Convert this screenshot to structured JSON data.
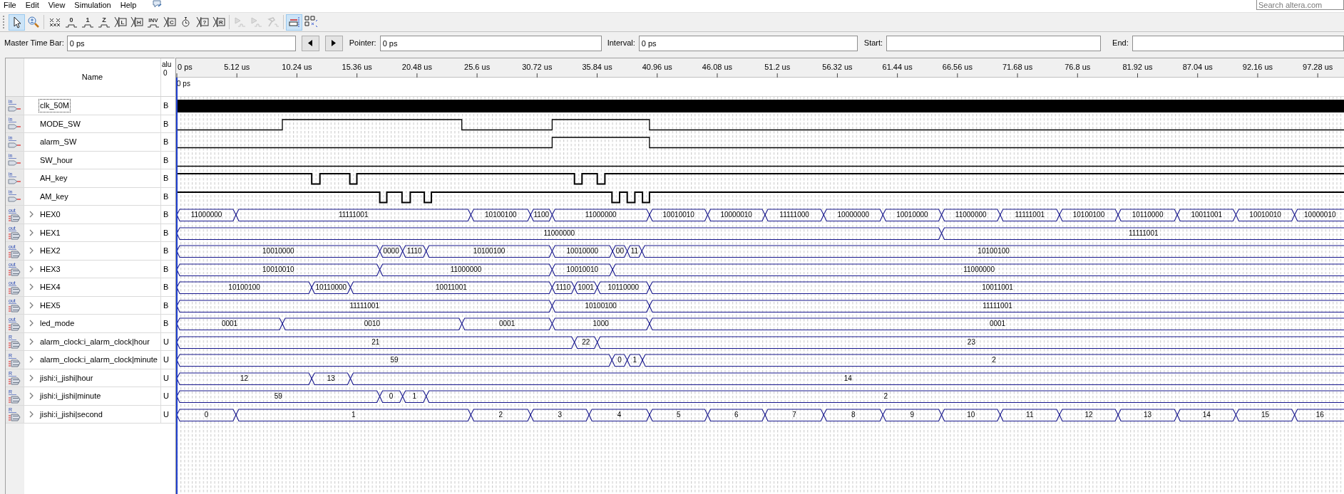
{
  "menu": [
    "File",
    "Edit",
    "View",
    "Simulation",
    "Help"
  ],
  "search": {
    "placeholder": "Search altera.com"
  },
  "toolbar": [
    {
      "kind": "pointer",
      "selected": true,
      "disabled": false
    },
    {
      "kind": "zoom",
      "selected": false,
      "disabled": false
    },
    {
      "kind": "unknown",
      "selected": false,
      "disabled": false
    },
    {
      "kind": "step",
      "label": "0",
      "selected": false,
      "disabled": false
    },
    {
      "kind": "step",
      "label": "1",
      "selected": false,
      "disabled": false
    },
    {
      "kind": "step",
      "label": "Z",
      "selected": false,
      "disabled": false
    },
    {
      "kind": "cross",
      "label": "L",
      "selected": false,
      "disabled": false
    },
    {
      "kind": "cross",
      "label": "H",
      "selected": false,
      "disabled": false
    },
    {
      "kind": "step",
      "label": "INV",
      "selected": false,
      "disabled": false
    },
    {
      "kind": "cross",
      "label": "C",
      "selected": false,
      "disabled": false
    },
    {
      "kind": "clock",
      "selected": false,
      "disabled": false
    },
    {
      "kind": "cross",
      "label": "?",
      "selected": false,
      "disabled": false
    },
    {
      "kind": "cross",
      "label": "R",
      "selected": false,
      "disabled": false
    },
    {
      "kind": "simulate",
      "selected": false,
      "disabled": true
    },
    {
      "kind": "simulate",
      "selected": false,
      "disabled": true
    },
    {
      "kind": "netlist",
      "selected": false,
      "disabled": true
    },
    {
      "kind": "snap",
      "selected": true,
      "disabled": false
    },
    {
      "kind": "grid",
      "selected": false,
      "disabled": false
    }
  ],
  "master_time_bar": {
    "label": "Master Time Bar:",
    "value": "0 ps"
  },
  "nav_buttons": [
    {
      "kind": "previous"
    },
    {
      "kind": "next"
    }
  ],
  "fields": [
    {
      "label": "Pointer:",
      "value": "0 ps"
    },
    {
      "label": "Interval:",
      "value": "0 ps"
    },
    {
      "label": "Start:"
    },
    {
      "label": "End:"
    }
  ],
  "columns": {
    "name": "Name",
    "value": "alu",
    "value_time": "0"
  },
  "time_ticks": [
    "0 ps",
    "5.12 us",
    "10.24 us",
    "15.36 us",
    "20.48 us",
    "25.6 us",
    "30.72 us",
    "35.84 us",
    "40.96 us",
    "46.08 us",
    "51.2 us",
    "56.32 us",
    "61.44 us",
    "66.56 us",
    "71.68 us",
    "76.8 us",
    "81.92 us",
    "87.04 us",
    "92.16 us",
    "97.28 us"
  ],
  "cursor": {
    "label": "0 ps"
  },
  "signals": [
    {
      "name": "clk_50M",
      "icon_text": "in",
      "kind": "input",
      "expandable": false,
      "focused": true,
      "value": "B",
      "wave": {
        "kind": "clock"
      }
    },
    {
      "name": "MODE_SW",
      "icon_text": "in",
      "kind": "input",
      "expandable": false,
      "focused": false,
      "value": "B",
      "wave": {
        "kind": "bit"
      }
    },
    {
      "name": "alarm_SW",
      "icon_text": "in",
      "kind": "input",
      "expandable": false,
      "focused": false,
      "value": "B",
      "wave": {
        "kind": "bit"
      }
    },
    {
      "name": "SW_hour",
      "icon_text": "in",
      "kind": "input",
      "expandable": false,
      "focused": false,
      "value": "B",
      "wave": {
        "kind": "bit"
      }
    },
    {
      "name": "AH_key",
      "icon_text": "in",
      "kind": "input",
      "expandable": false,
      "focused": false,
      "value": "B",
      "wave": {
        "kind": "bit"
      }
    },
    {
      "name": "AM_key",
      "icon_text": "in",
      "kind": "input",
      "expandable": false,
      "focused": false,
      "value": "B",
      "wave": {
        "kind": "bit"
      }
    },
    {
      "name": "HEX0",
      "icon_text": "out",
      "kind": "output",
      "expandable": true,
      "focused": false,
      "value": "B",
      "wave": {
        "kind": "bus",
        "segments": [
          "11000000",
          "11111001",
          "10100100",
          "1100",
          "11000000",
          "10010010",
          "10000010",
          "11111000",
          "10000000",
          "10010000",
          "11000000",
          "11111001",
          "10100100",
          "10110000",
          "10011001",
          "10010010",
          "10000010"
        ]
      }
    },
    {
      "name": "HEX1",
      "icon_text": "out",
      "kind": "output",
      "expandable": true,
      "focused": false,
      "value": "B",
      "wave": {
        "kind": "bus",
        "segments": [
          "11000000",
          "11111001"
        ]
      }
    },
    {
      "name": "HEX2",
      "icon_text": "out",
      "kind": "output",
      "expandable": true,
      "focused": false,
      "value": "B",
      "wave": {
        "kind": "bus",
        "segments": [
          "10010000",
          "0000",
          "1110",
          "10100100",
          "10010000",
          "00",
          "11",
          "10100100"
        ]
      }
    },
    {
      "name": "HEX3",
      "icon_text": "out",
      "kind": "output",
      "expandable": true,
      "focused": false,
      "value": "B",
      "wave": {
        "kind": "bus",
        "segments": [
          "10010010",
          "11000000",
          "10010010",
          "11000000"
        ]
      }
    },
    {
      "name": "HEX4",
      "icon_text": "out",
      "kind": "output",
      "expandable": true,
      "focused": false,
      "value": "B",
      "wave": {
        "kind": "bus",
        "segments": [
          "10100100",
          "10110000",
          "10011001",
          "1110",
          "1001",
          "10110000",
          "10011001"
        ]
      }
    },
    {
      "name": "HEX5",
      "icon_text": "out",
      "kind": "output",
      "expandable": true,
      "focused": false,
      "value": "B",
      "wave": {
        "kind": "bus",
        "segments": [
          "11111001",
          "10100100",
          "11111001"
        ]
      }
    },
    {
      "name": "led_mode",
      "icon_text": "out",
      "kind": "output",
      "expandable": true,
      "focused": false,
      "value": "B",
      "wave": {
        "kind": "bus",
        "segments": [
          "0001",
          "0010",
          "0001",
          "1000",
          "0001"
        ]
      }
    },
    {
      "name": "alarm_clock:i_alarm_clock|hour",
      "icon_text": "R",
      "kind": "register",
      "expandable": true,
      "focused": false,
      "value": "U",
      "wave": {
        "kind": "bus",
        "segments": [
          "21",
          "22",
          "23"
        ]
      }
    },
    {
      "name": "alarm_clock:i_alarm_clock|minute",
      "icon_text": "R",
      "kind": "register",
      "expandable": true,
      "focused": false,
      "value": "U",
      "wave": {
        "kind": "bus",
        "segments": [
          "59",
          "0",
          "1",
          "2"
        ]
      }
    },
    {
      "name": "jishi:i_jishi|hour",
      "icon_text": "R",
      "kind": "register",
      "expandable": true,
      "focused": false,
      "value": "U",
      "wave": {
        "kind": "bus",
        "segments": [
          "12",
          "13",
          "14"
        ]
      }
    },
    {
      "name": "jishi:i_jishi|minute",
      "icon_text": "R",
      "kind": "register",
      "expandable": true,
      "focused": false,
      "value": "U",
      "wave": {
        "kind": "bus",
        "segments": [
          "59",
          "0",
          "1",
          "2"
        ]
      }
    },
    {
      "name": "jishi:i_jishi|second",
      "icon_text": "R",
      "kind": "register",
      "expandable": true,
      "focused": false,
      "value": "U",
      "wave": {
        "kind": "bus",
        "segments": [
          "0",
          "1",
          "2",
          "3",
          "4",
          "5",
          "6",
          "7",
          "8",
          "9",
          "10",
          "11",
          "12",
          "13",
          "14",
          "15",
          "16"
        ]
      }
    }
  ]
}
